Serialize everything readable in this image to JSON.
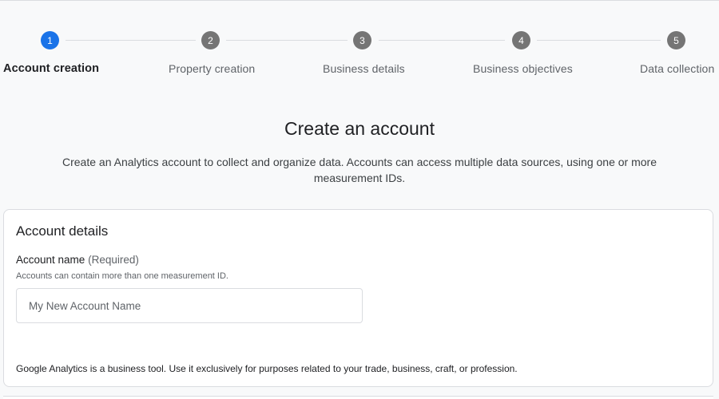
{
  "stepper": {
    "steps": [
      {
        "number": "1",
        "label": "Account creation",
        "state": "active"
      },
      {
        "number": "2",
        "label": "Property creation",
        "state": "pending"
      },
      {
        "number": "3",
        "label": "Business details",
        "state": "pending"
      },
      {
        "number": "4",
        "label": "Business objectives",
        "state": "pending"
      },
      {
        "number": "5",
        "label": "Data collection",
        "state": "pending"
      }
    ]
  },
  "header": {
    "title": "Create an account",
    "description": "Create an Analytics account to collect and organize data. Accounts can access multiple data sources, using one or more measurement IDs."
  },
  "account_details": {
    "title": "Account details",
    "account_name": {
      "label": "Account name",
      "required": "(Required)",
      "hint": "Accounts can contain more than one measurement ID.",
      "value": "",
      "placeholder": "My New Account Name"
    },
    "footer_note": "Google Analytics is a business tool. Use it exclusively for purposes related to your trade, business, craft, or profession."
  },
  "colors": {
    "active_step": "#1a73e8",
    "pending_step": "#757575",
    "background": "#f8f9fa"
  }
}
